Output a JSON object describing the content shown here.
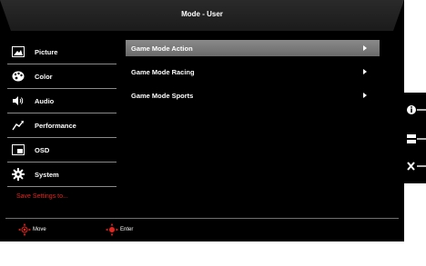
{
  "header": {
    "title": "Mode - User"
  },
  "sidebar": {
    "items": [
      {
        "label": "Picture",
        "icon": "picture-icon"
      },
      {
        "label": "Color",
        "icon": "color-palette-icon"
      },
      {
        "label": "Audio",
        "icon": "speaker-icon"
      },
      {
        "label": "Performance",
        "icon": "performance-icon"
      },
      {
        "label": "OSD",
        "icon": "osd-icon"
      },
      {
        "label": "System",
        "icon": "gear-icon"
      }
    ],
    "save_label": "Save Settings to..."
  },
  "main": {
    "options": [
      {
        "label": "Game Mode Action",
        "selected": true
      },
      {
        "label": "Game Mode Racing",
        "selected": false
      },
      {
        "label": "Game Mode Sports",
        "selected": false
      }
    ]
  },
  "footer": {
    "move_label": "Move",
    "enter_label": "Enter"
  },
  "side_buttons": [
    "info-icon",
    "menu-icon",
    "close-icon"
  ],
  "colors": {
    "background": "#000000",
    "accent_red": "#e0261f",
    "selection": "#7a7a7a",
    "text": "#ffffff"
  }
}
